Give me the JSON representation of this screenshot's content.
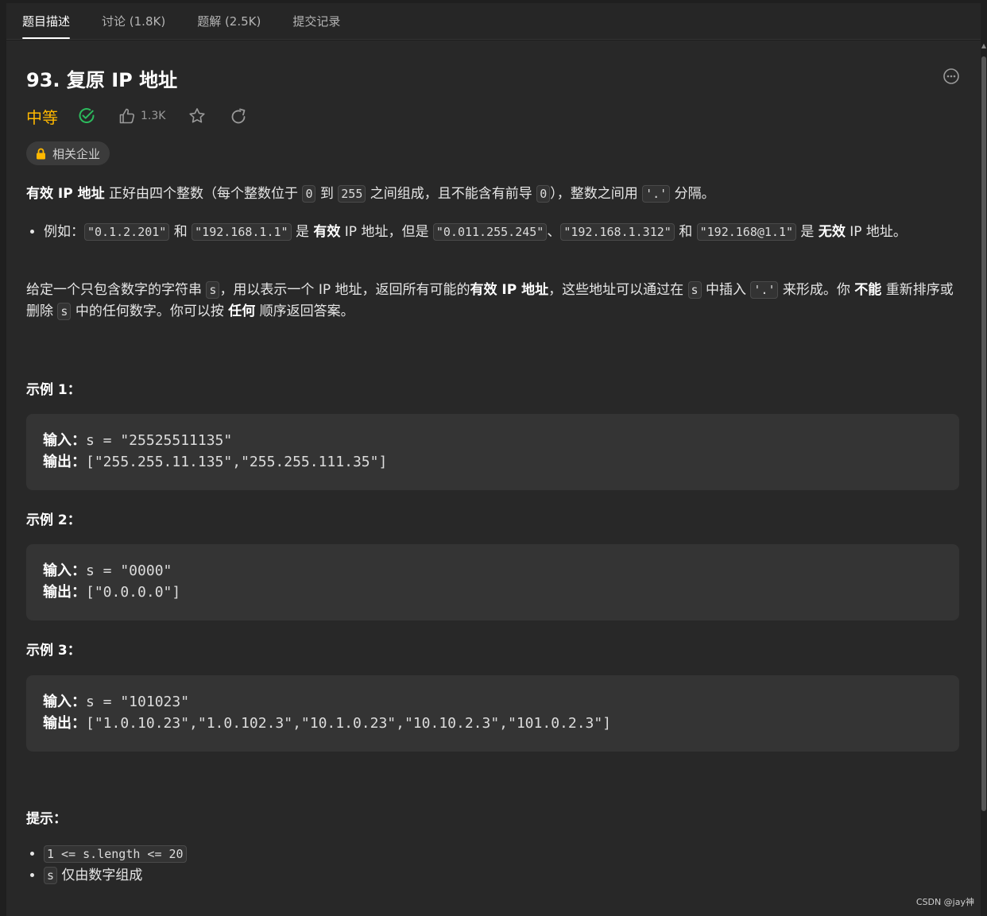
{
  "tabs": [
    {
      "label": "题目描述",
      "active": true
    },
    {
      "label": "讨论 (1.8K)",
      "active": false
    },
    {
      "label": "题解 (2.5K)",
      "active": false
    },
    {
      "label": "提交记录",
      "active": false
    }
  ],
  "problem": {
    "title": "93. 复原 IP 地址",
    "difficulty": "中等",
    "difficulty_color": "#ffb800",
    "likes": "1.3K",
    "company_tag": "相关企业"
  },
  "desc": {
    "p1": {
      "b1": "有效 IP 地址",
      "t1": " 正好由四个整数（每个整数位于 ",
      "c1": "0",
      "t2": " 到 ",
      "c2": "255",
      "t3": " 之间组成，且不能含有前导 ",
      "c3": "0",
      "t4": "），整数之间用 ",
      "c4": "'.'",
      "t5": " 分隔。"
    },
    "bullet": {
      "t1": "例如：",
      "c1": "\"0.1.2.201\"",
      "t2": " 和 ",
      "c2": "\"192.168.1.1\"",
      "t3": " 是 ",
      "b1": "有效",
      "t4": " IP 地址，但是 ",
      "c3": "\"0.011.255.245\"",
      "t5": "、",
      "c4": "\"192.168.1.312\"",
      "t6": " 和 ",
      "c5": "\"192.168@1.1\"",
      "t7": " 是 ",
      "b2": "无效",
      "t8": " IP 地址。"
    },
    "p2": {
      "t1": "给定一个只包含数字的字符串 ",
      "c1": "s",
      "t2": "，用以表示一个 IP 地址，返回所有可能的",
      "b1": "有效 IP 地址",
      "t3": "，这些地址可以通过在 ",
      "c2": "s",
      "t4": " 中插入 ",
      "c3": "'.'",
      "t5": " 来形成。你 ",
      "b2": "不能",
      "t6": " 重新排序或删除 ",
      "c4": "s",
      "t7": " 中的任何数字。你可以按 ",
      "b3": "任何",
      "t8": " 顺序返回答案。"
    }
  },
  "examples": [
    {
      "title": "示例 1：",
      "input_label": "输入：",
      "input": "s = \"25525511135\"",
      "output_label": "输出：",
      "output": "[\"255.255.11.135\",\"255.255.111.35\"]"
    },
    {
      "title": "示例 2：",
      "input_label": "输入：",
      "input": "s = \"0000\"",
      "output_label": "输出：",
      "output": "[\"0.0.0.0\"]"
    },
    {
      "title": "示例 3：",
      "input_label": "输入：",
      "input": "s = \"101023\"",
      "output_label": "输出：",
      "output": "[\"1.0.10.23\",\"1.0.102.3\",\"10.1.0.23\",\"10.10.2.3\",\"101.0.2.3\"]"
    }
  ],
  "hints": {
    "title": "提示：",
    "h1_code": "1 <= s.length <= 20",
    "h2_code": "s",
    "h2_text": " 仅由数字组成"
  },
  "watermark": "CSDN @jay神"
}
